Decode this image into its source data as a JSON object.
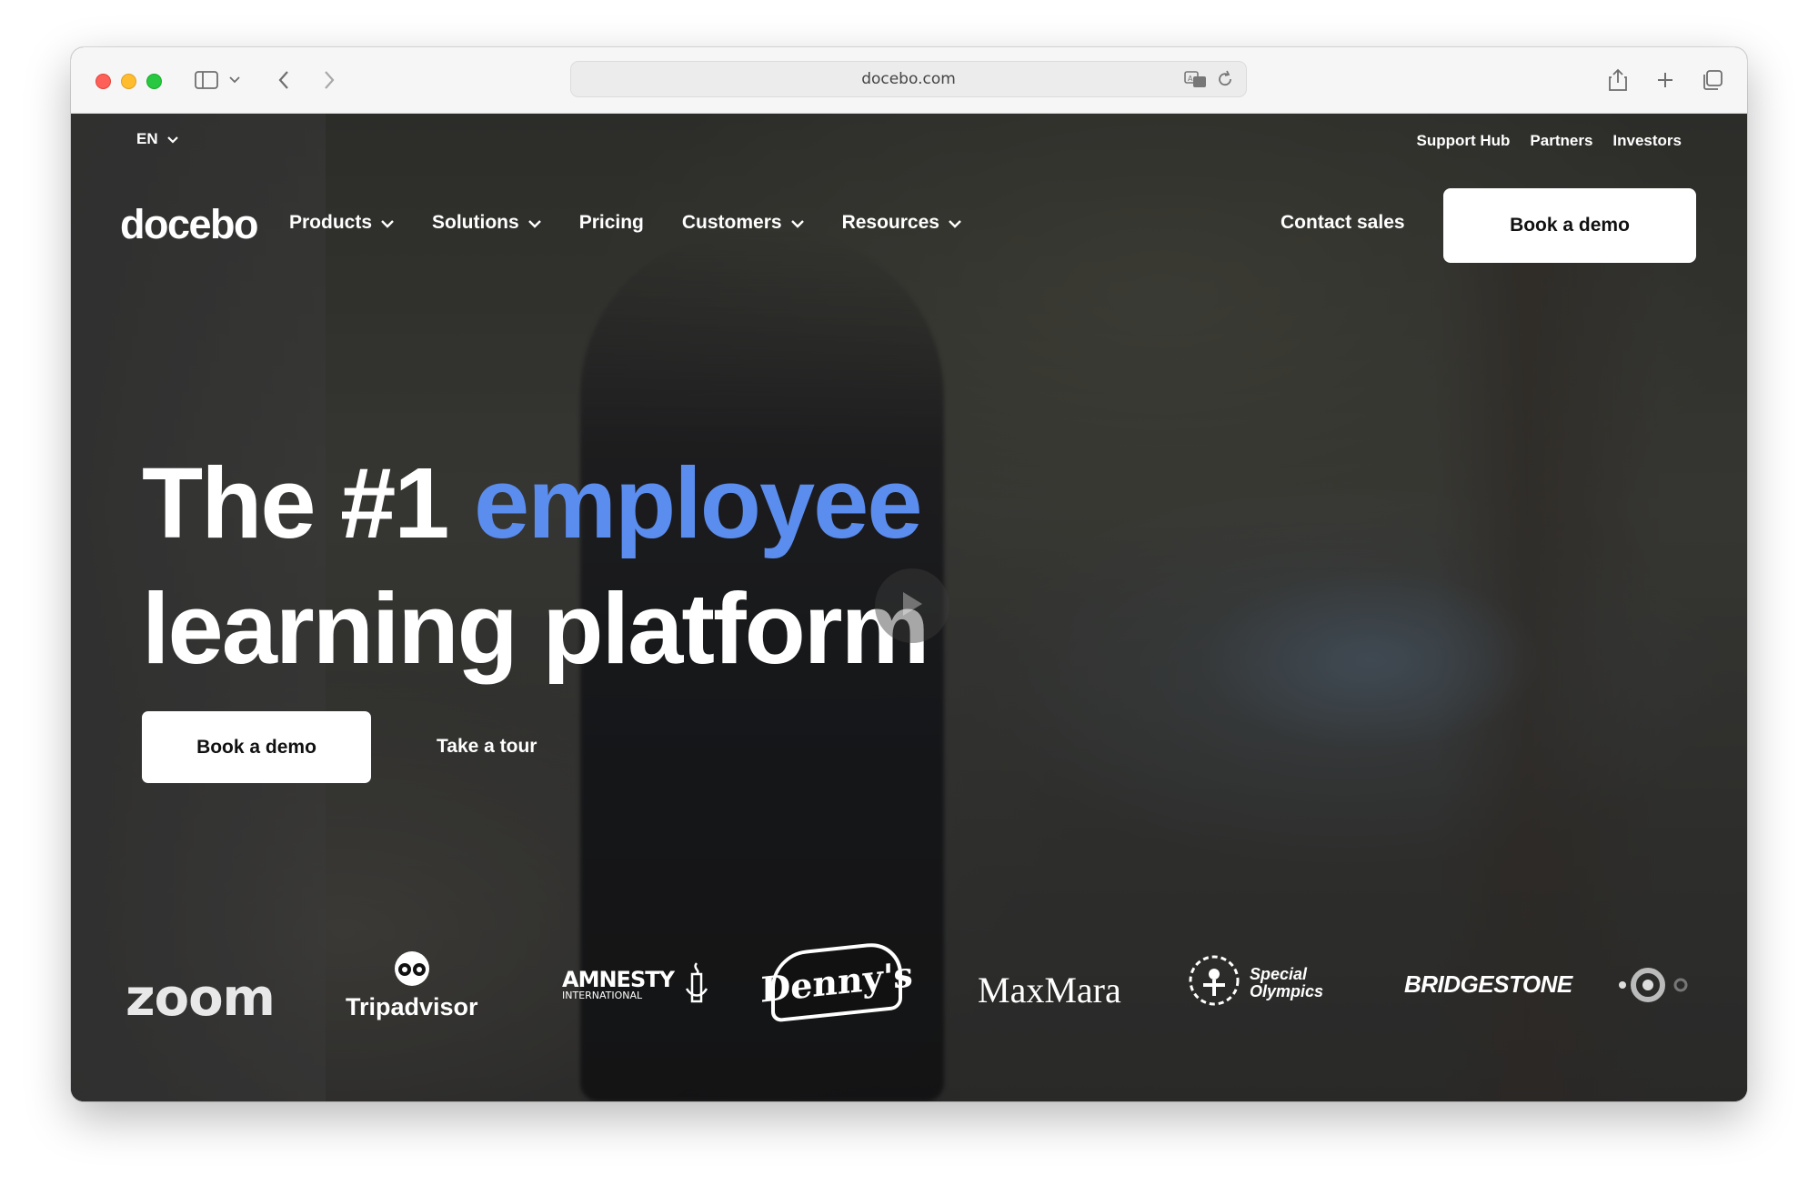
{
  "browser": {
    "url": "docebo.com"
  },
  "utility": {
    "language": "EN",
    "links": [
      "Support Hub",
      "Partners",
      "Investors"
    ]
  },
  "nav": {
    "logo": "docebo",
    "items": [
      {
        "label": "Products",
        "has_dropdown": true
      },
      {
        "label": "Solutions",
        "has_dropdown": true
      },
      {
        "label": "Pricing",
        "has_dropdown": false
      },
      {
        "label": "Customers",
        "has_dropdown": true
      },
      {
        "label": "Resources",
        "has_dropdown": true
      }
    ],
    "contact_label": "Contact sales",
    "book_demo_label": "Book a demo"
  },
  "hero": {
    "title_before": "The #1 ",
    "title_accent": "employee",
    "title_line2": "learning platform",
    "primary_cta": "Book a demo",
    "secondary_cta": "Take a tour",
    "accent_color": "#5b8def"
  },
  "customers": {
    "logos": [
      "zoom",
      "Tripadvisor",
      "AMNESTY",
      "INTERNATIONAL",
      "Denny's",
      "MaxMara",
      "Special",
      "Olympics",
      "BRIDGESTONE"
    ]
  }
}
